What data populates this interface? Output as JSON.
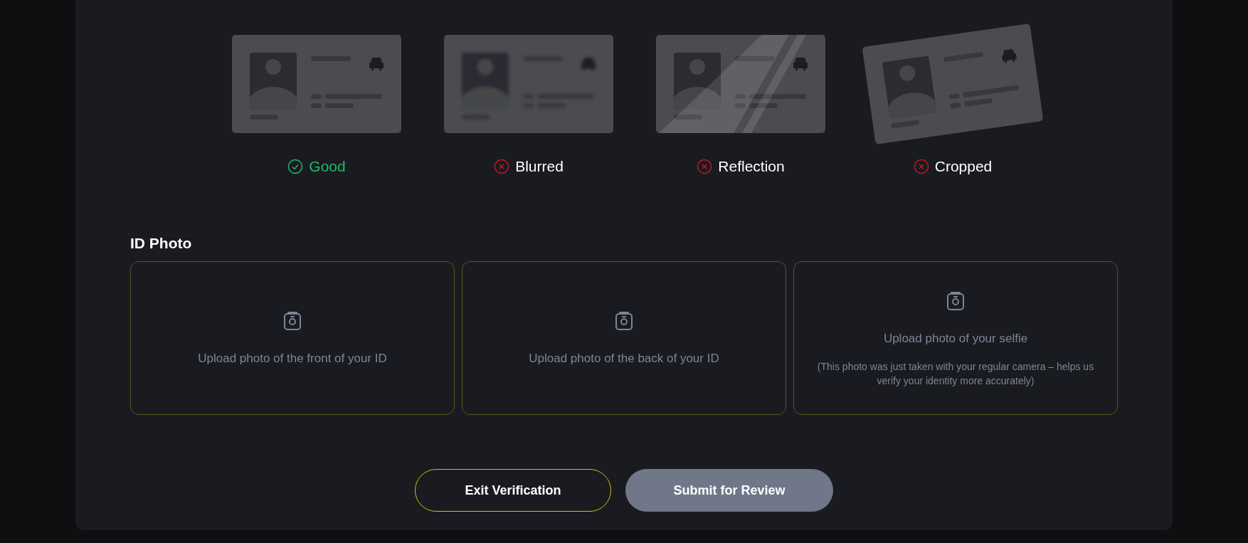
{
  "examples": [
    {
      "kind": "good",
      "label": "Good",
      "ok": true
    },
    {
      "kind": "blurred",
      "label": "Blurred",
      "ok": false
    },
    {
      "kind": "reflection",
      "label": "Reflection",
      "ok": false
    },
    {
      "kind": "cropped",
      "label": "Cropped",
      "ok": false
    }
  ],
  "id_photo": {
    "title": "ID Photo",
    "uploads": [
      {
        "label": "Upload photo of the front of your ID"
      },
      {
        "label": "Upload photo of the back of your ID"
      },
      {
        "label": "Upload photo of your selfie",
        "note": "(This photo was just taken with your regular camera – helps us verify your identity more accurately)"
      }
    ]
  },
  "buttons": [
    {
      "label": "Exit Verification",
      "kind": "outline"
    },
    {
      "label": "Submit for Review",
      "kind": "filled"
    }
  ]
}
